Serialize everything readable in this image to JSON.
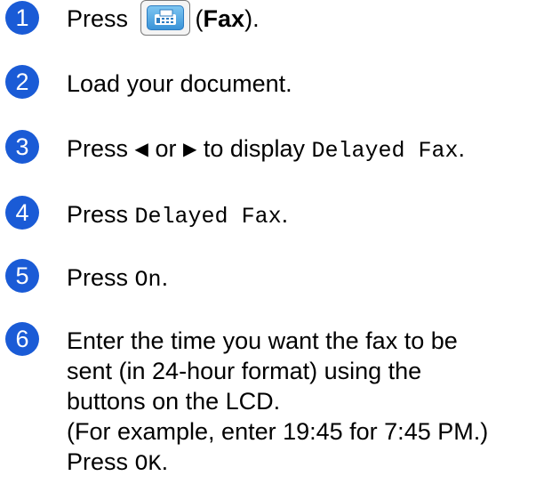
{
  "steps": [
    {
      "number": "1",
      "press": "Press",
      "paren_open": "(",
      "fax_label": "Fax",
      "paren_close": ").",
      "icon": "fax-icon"
    },
    {
      "number": "2",
      "text": "Load your document."
    },
    {
      "number": "3",
      "press": "Press",
      "left_arrow": "◀",
      "or": "or",
      "right_arrow": "▶",
      "to_display": "to display",
      "option": "Delayed Fax",
      "period": "."
    },
    {
      "number": "4",
      "press": "Press",
      "option": "Delayed Fax",
      "period": "."
    },
    {
      "number": "5",
      "press": "Press",
      "option": "On",
      "period": "."
    },
    {
      "number": "6",
      "lines": [
        "Enter the time you want the fax to be",
        "sent (in 24-hour format) using the",
        "buttons on the LCD.",
        "(For example, enter 19:45 for 7:45 PM.)"
      ],
      "press": "Press",
      "option": "OK",
      "period": "."
    }
  ],
  "colors": {
    "step_circle": "#1a5bd6",
    "fax_button": "#3a93d8"
  }
}
